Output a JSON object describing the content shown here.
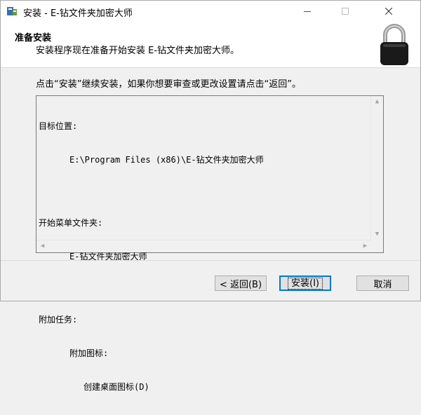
{
  "window": {
    "title": "安装 - E-钻文件夹加密大师"
  },
  "header": {
    "title": "准备安装",
    "subtitle": "安装程序现在准备开始安装 E-钻文件夹加密大师。"
  },
  "instruction": "点击“安装”继续安装，如果你想要审查或更改设置请点击“返回”。",
  "summary": {
    "dest_label": "目标位置:",
    "dest_value": "E:\\Program Files (x86)\\E-钻文件夹加密大师",
    "start_menu_label": "开始菜单文件夹:",
    "start_menu_value": "E-钻文件夹加密大师",
    "tasks_label": "附加任务:",
    "tasks_group": "附加图标:",
    "tasks_item": "创建桌面图标(D)"
  },
  "buttons": {
    "back": "< 返回(B)",
    "install": "安装(I)",
    "cancel": "取消"
  },
  "icons": {
    "app": "installer-icon",
    "lock": "padlock-icon"
  }
}
